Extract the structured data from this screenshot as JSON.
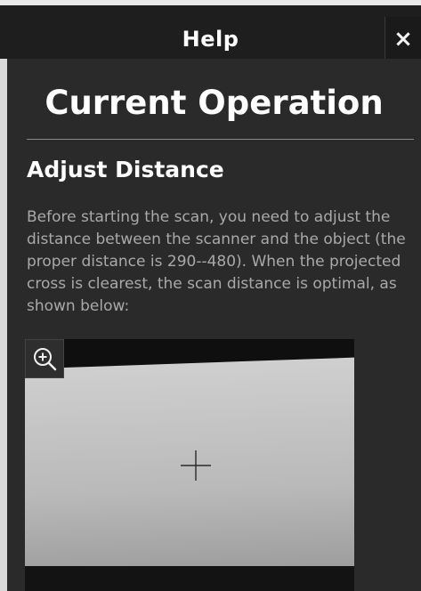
{
  "dialog": {
    "title": "Help",
    "close_label": "×"
  },
  "content": {
    "heading": "Current Operation",
    "subheading": "Adjust Distance",
    "description": "Before starting the scan, you need to adjust the distance between the scanner and the object (the proper distance is 290--480). When the projected cross is clearest, the scan distance is optimal, as shown below:"
  },
  "preview": {
    "zoom_icon": "zoom-in-icon"
  },
  "colors": {
    "title_bar": "#1e1e1e",
    "panel": "#2a2a2a",
    "text": "#ffffff",
    "description": "#a9a9a9"
  }
}
